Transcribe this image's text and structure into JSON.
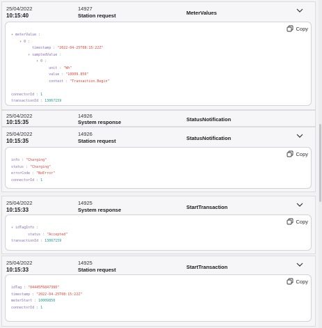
{
  "entries": [
    {
      "date": "25/04/2022",
      "time": "10:15:40",
      "id": "14927",
      "direction": "Station request",
      "action": "MeterValues",
      "copy_label": "Copy",
      "payload": {
        "meterValue_key": "meterValue",
        "idx0": "0",
        "timestamp_key": "timestamp",
        "timestamp_val": "\"2022-04-25T08:15:22Z\"",
        "sampledValue_key": "sampledValue",
        "idx1": "0",
        "unit_key": "unit",
        "unit_val": "\"Wh\"",
        "value_key": "value",
        "value_val": "\"10009.850\"",
        "context_key": "context",
        "context_val": "\"Transaction.Begin\"",
        "connectorId_key": "connectorId",
        "connectorId_val": "1",
        "transactionId_key": "transactionId",
        "transactionId_val": "13067159"
      }
    },
    {
      "date": "25/04/2022",
      "time": "10:15:35",
      "id": "14926",
      "direction": "System response",
      "action": "StatusNotification"
    },
    {
      "date": "25/04/2022",
      "time": "10:15:35",
      "id": "14926",
      "direction": "Station request",
      "action": "StatusNotification",
      "copy_label": "Copy",
      "payload": {
        "info_key": "info",
        "info_val": "\"Charging\"",
        "status_key": "status",
        "status_val": "\"Charging\"",
        "errorCode_key": "errorCode",
        "errorCode_val": "\"NoError\"",
        "connectorId_key": "connectorId",
        "connectorId_val": "1"
      }
    },
    {
      "date": "25/04/2022",
      "time": "10:15:33",
      "id": "14925",
      "direction": "System response",
      "action": "StartTransaction",
      "copy_label": "Copy",
      "payload": {
        "idTagInfo_key": "idTagInfo",
        "status_key": "status",
        "status_val": "\"Accepted\"",
        "transactionId_key": "transactionId",
        "transactionId_val": "13067159"
      }
    },
    {
      "date": "25/04/2022",
      "time": "10:15:33",
      "id": "14925",
      "direction": "Station request",
      "action": "StartTransaction",
      "copy_label": "Copy",
      "payload": {
        "idTag_key": "idTag",
        "idTag_val": "\"04445F6847380\"",
        "timestamp_key": "timestamp",
        "timestamp_val": "\"2022-04-25T08:15:22Z\"",
        "meterStart_key": "meterStart",
        "meterStart_val": "10009850",
        "connectorId_key": "connectorId",
        "connectorId_val": "1"
      }
    }
  ],
  "icons": {
    "expand": "chevron-down-icon",
    "copy": "copy-icon"
  },
  "colors": {
    "key": "#8a6db8",
    "string": "#d8483a",
    "number": "#1a9a8a",
    "card_bg": "#ffffff",
    "row_bg": "#f6f6f8"
  }
}
